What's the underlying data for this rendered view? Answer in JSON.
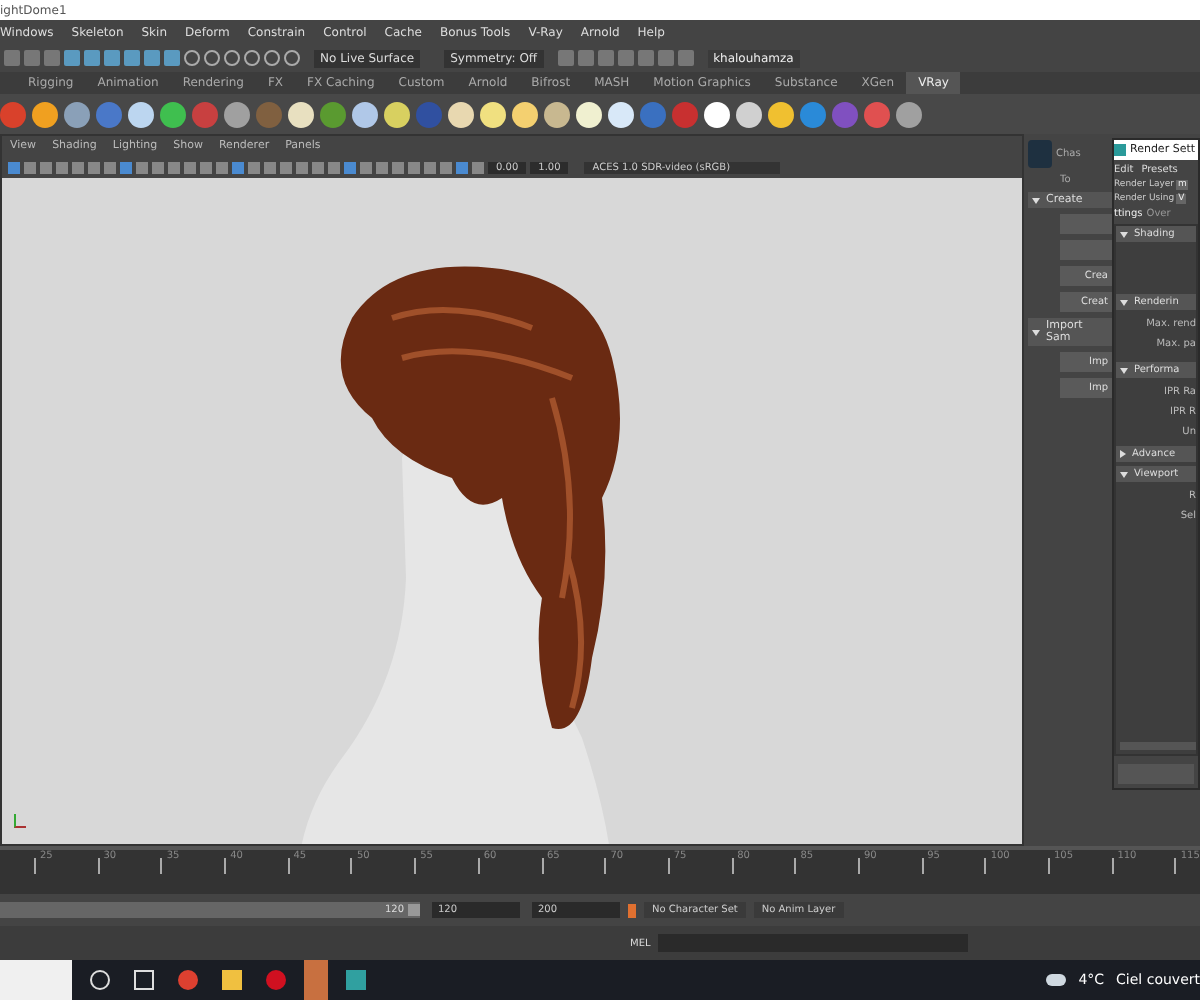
{
  "window": {
    "title": "ightDome1"
  },
  "menu_bar": [
    "Windows",
    "Skeleton",
    "Skin",
    "Deform",
    "Constrain",
    "Control",
    "Cache",
    "Bonus Tools",
    "V-Ray",
    "Arnold",
    "Help"
  ],
  "status_line": {
    "live_surface": "No Live Surface",
    "symmetry": "Symmetry: Off",
    "user": "khalouhamza"
  },
  "shelf_tabs": [
    {
      "label": "Rigging",
      "selected": false
    },
    {
      "label": "Animation",
      "selected": false
    },
    {
      "label": "Rendering",
      "selected": false
    },
    {
      "label": "FX",
      "selected": false
    },
    {
      "label": "FX Caching",
      "selected": false
    },
    {
      "label": "Custom",
      "selected": false
    },
    {
      "label": "Arnold",
      "selected": false
    },
    {
      "label": "Bifrost",
      "selected": false
    },
    {
      "label": "MASH",
      "selected": false
    },
    {
      "label": "Motion Graphics",
      "selected": false
    },
    {
      "label": "Substance",
      "selected": false
    },
    {
      "label": "XGen",
      "selected": false
    },
    {
      "label": "VRay",
      "selected": true
    }
  ],
  "viewport": {
    "menu": [
      "View",
      "Shading",
      "Lighting",
      "Show",
      "Renderer",
      "Panels"
    ],
    "exposure": "0.00",
    "gamma": "1.00",
    "color_space": "ACES 1.0 SDR-video (sRGB)"
  },
  "side_panel": {
    "header": "Chas",
    "subheader": "To",
    "sections": [
      {
        "label": "Create",
        "expanded": true,
        "buttons": [
          {
            "label": "Crea"
          },
          {
            "label": "Creat"
          }
        ]
      },
      {
        "label": "Import Sam",
        "expanded": true,
        "buttons": [
          {
            "label": "Imp"
          },
          {
            "label": "Imp"
          }
        ]
      }
    ]
  },
  "render_settings": {
    "title": "Render Sett",
    "menu": [
      "Edit",
      "Presets"
    ],
    "render_layer": {
      "label": "Render Layer",
      "value": "m"
    },
    "render_using": {
      "label": "Render Using",
      "value": "V"
    },
    "tabs": [
      {
        "label": "ttings",
        "selected": true
      },
      {
        "label": "Over",
        "selected": false
      }
    ],
    "sections": [
      {
        "label": "Shading",
        "expanded": true
      },
      {
        "label": "Renderin",
        "expanded": true,
        "fields": [
          "Max. rend",
          "Max. pa"
        ]
      },
      {
        "label": "Performa",
        "expanded": true,
        "fields": [
          "IPR Ra",
          "IPR R",
          "Un"
        ]
      },
      {
        "label": "Advance",
        "expanded": false
      },
      {
        "label": "Viewport",
        "expanded": true,
        "fields": [
          "R",
          "Sel"
        ]
      }
    ]
  },
  "timeline": {
    "ticks": [
      "25",
      "30",
      "35",
      "40",
      "45",
      "50",
      "55",
      "60",
      "65",
      "70",
      "75",
      "80",
      "85",
      "90",
      "95",
      "100",
      "105",
      "110",
      "115"
    ]
  },
  "range": {
    "level": 1,
    "current": "120",
    "start": "120",
    "end": "200",
    "character_set": "No Character Set",
    "anim_layer": "No Anim Layer"
  },
  "command_line": {
    "language": "MEL"
  },
  "taskbar": {
    "temperature": "4°C",
    "weather": "Ciel couvert"
  }
}
